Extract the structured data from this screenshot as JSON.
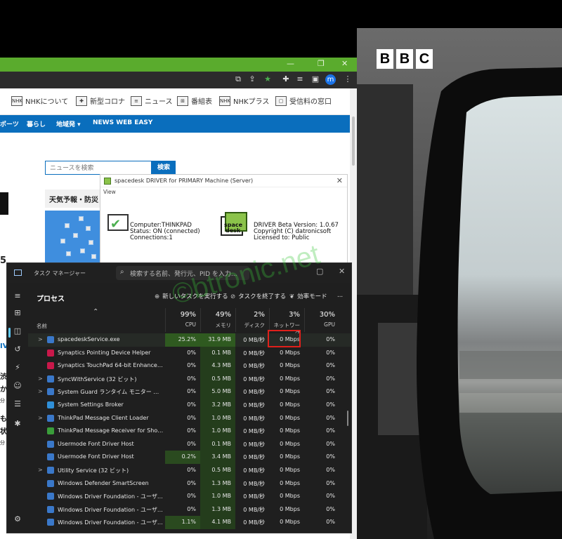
{
  "browser": {
    "header_links": [
      {
        "icon": "NHK",
        "label": "NHKについて"
      },
      {
        "icon": "",
        "label": "新型コロナ"
      },
      {
        "icon": "",
        "label": "ニュース"
      },
      {
        "icon": "",
        "label": "番組表"
      },
      {
        "icon": "NHK",
        "label": "NHKプラス"
      },
      {
        "icon": "",
        "label": "受信料の窓口"
      }
    ],
    "nav": [
      "ポーツ",
      "暮らし",
      "地域発 ▾",
      "NEWS WEB EASY"
    ],
    "search_placeholder": "ニュースを検索",
    "search_button": "検索",
    "weather_title": "天気予報・防災",
    "avatar_letter": "m",
    "left_fragments": [
      "5",
      "IV",
      "渋",
      "か",
      "分",
      "も",
      "状",
      "分"
    ]
  },
  "spacedesk": {
    "title": "spacedesk DRIVER for PRIMARY Machine (Server)",
    "menu": "View",
    "computer": "Computer:THINKPAD",
    "status": "Status: ON (connected)",
    "connections": "Connections:1",
    "version": "DRIVER Beta Version: 1.0.67",
    "copyright": "Copyright (C) datronicsoft",
    "license": "Licensed to:  Public",
    "logo_text_1": "space",
    "logo_text_2": "desk"
  },
  "taskmanager": {
    "app_name": "タスク マネージャー",
    "search_placeholder": "検索する名前、発行元、PID を入力...",
    "section_title": "プロセス",
    "btn_new_task": "新しいタスクを実行する",
    "btn_end_task": "タスクを終了する",
    "btn_efficiency": "効率モード",
    "btn_more": "...",
    "name_header": "名前",
    "columns": [
      {
        "pct": "99%",
        "label": "CPU"
      },
      {
        "pct": "49%",
        "label": "メモリ"
      },
      {
        "pct": "2%",
        "label": "ディスク"
      },
      {
        "pct": "3%",
        "label": "ネットワーク"
      },
      {
        "pct": "30%",
        "label": "GPU"
      }
    ],
    "rows": [
      {
        "expand": ">",
        "icon_color": "#3a78c9",
        "name": "spacedeskService.exe",
        "cpu": "25.2%",
        "mem": "31.9 MB",
        "disk": "0 MB/秒",
        "net": "0 Mbps",
        "gpu": "0%"
      },
      {
        "expand": "",
        "icon_color": "#c9184a",
        "name": "Synaptics Pointing Device Helper",
        "cpu": "0%",
        "mem": "0.1 MB",
        "disk": "0 MB/秒",
        "net": "0 Mbps",
        "gpu": "0%"
      },
      {
        "expand": "",
        "icon_color": "#c9184a",
        "name": "Synaptics TouchPad 64-bit Enhancements",
        "cpu": "0%",
        "mem": "4.3 MB",
        "disk": "0 MB/秒",
        "net": "0 Mbps",
        "gpu": "0%"
      },
      {
        "expand": ">",
        "icon_color": "#3a78c9",
        "name": "SyncWithService (32 ビット)",
        "cpu": "0%",
        "mem": "0.5 MB",
        "disk": "0 MB/秒",
        "net": "0 Mbps",
        "gpu": "0%"
      },
      {
        "expand": ">",
        "icon_color": "#3a78c9",
        "name": "System Guard ランタイム モニター ブローカー サ...",
        "cpu": "0%",
        "mem": "5.0 MB",
        "disk": "0 MB/秒",
        "net": "0 Mbps",
        "gpu": "0%"
      },
      {
        "expand": "",
        "icon_color": "#2f8fd8",
        "name": "System Settings Broker",
        "cpu": "0%",
        "mem": "3.2 MB",
        "disk": "0 MB/秒",
        "net": "0 Mbps",
        "gpu": "0%"
      },
      {
        "expand": ">",
        "icon_color": "#3a78c9",
        "name": "ThinkPad Message Client Loader",
        "cpu": "0%",
        "mem": "1.0 MB",
        "disk": "0 MB/秒",
        "net": "0 Mbps",
        "gpu": "0%"
      },
      {
        "expand": "",
        "icon_color": "#3a9d3a",
        "name": "ThinkPad Message Receiver for Shortcut ...",
        "cpu": "0%",
        "mem": "1.0 MB",
        "disk": "0 MB/秒",
        "net": "0 Mbps",
        "gpu": "0%"
      },
      {
        "expand": "",
        "icon_color": "#3a78c9",
        "name": "Usermode Font Driver Host",
        "cpu": "0%",
        "mem": "0.1 MB",
        "disk": "0 MB/秒",
        "net": "0 Mbps",
        "gpu": "0%"
      },
      {
        "expand": "",
        "icon_color": "#3a78c9",
        "name": "Usermode Font Driver Host",
        "cpu": "0.2%",
        "mem": "3.4 MB",
        "disk": "0 MB/秒",
        "net": "0 Mbps",
        "gpu": "0%"
      },
      {
        "expand": ">",
        "icon_color": "#3a78c9",
        "name": "Utility Service (32 ビット)",
        "cpu": "0%",
        "mem": "0.5 MB",
        "disk": "0 MB/秒",
        "net": "0 Mbps",
        "gpu": "0%"
      },
      {
        "expand": "",
        "icon_color": "#3a78c9",
        "name": "Windows Defender SmartScreen",
        "cpu": "0%",
        "mem": "1.3 MB",
        "disk": "0 MB/秒",
        "net": "0 Mbps",
        "gpu": "0%"
      },
      {
        "expand": "",
        "icon_color": "#3a78c9",
        "name": "Windows Driver Foundation - ユーザー モー...",
        "cpu": "0%",
        "mem": "1.0 MB",
        "disk": "0 MB/秒",
        "net": "0 Mbps",
        "gpu": "0%"
      },
      {
        "expand": "",
        "icon_color": "#3a78c9",
        "name": "Windows Driver Foundation - ユーザー モー...",
        "cpu": "0%",
        "mem": "1.3 MB",
        "disk": "0 MB/秒",
        "net": "0 Mbps",
        "gpu": "0%"
      },
      {
        "expand": "",
        "icon_color": "#3a78c9",
        "name": "Windows Driver Foundation - ユーザー モー...",
        "cpu": "1.1%",
        "mem": "4.1 MB",
        "disk": "0 MB/秒",
        "net": "0 Mbps",
        "gpu": "0%"
      }
    ]
  },
  "video": {
    "logo_letters": [
      "B",
      "B",
      "C"
    ]
  },
  "watermark": "©btronic.net",
  "colors": {
    "chrome_green": "#5aab2d",
    "nhk_blue": "#0a6ebd",
    "tm_bg": "#1f1f1f",
    "highlight_red": "#e0201b"
  }
}
